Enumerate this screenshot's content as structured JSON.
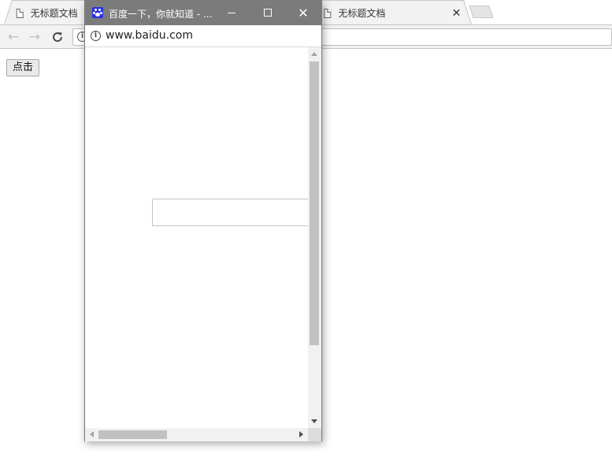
{
  "browser": {
    "tabs": [
      {
        "label": "无标题文档"
      },
      {
        "label": "无标题文档",
        "close": "✕"
      }
    ],
    "toolbar": {
      "back": "←",
      "forward": "→",
      "reload": "C"
    }
  },
  "page": {
    "button_label": "点击"
  },
  "popup": {
    "title": "百度一下，你就知道 - ...",
    "url": "www.baidu.com",
    "close_glyph": "✕",
    "titlebar_color": "#7b7b7b",
    "favicon_color": "#2932e1"
  }
}
